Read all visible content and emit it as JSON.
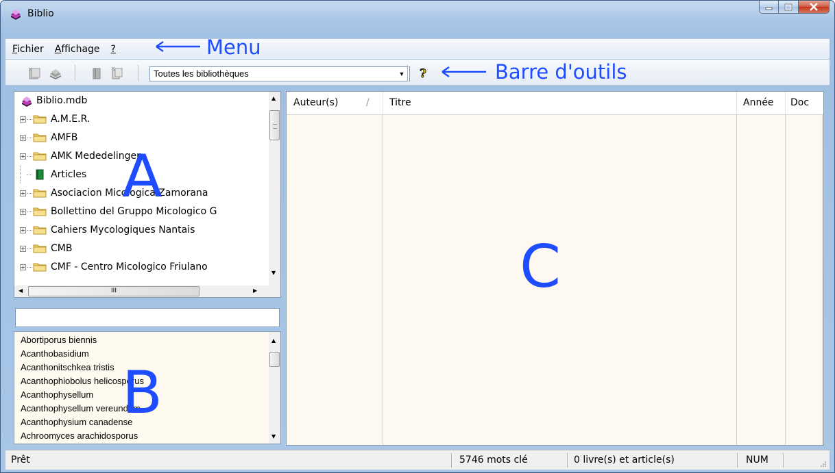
{
  "window": {
    "title": "Biblio"
  },
  "menu": {
    "file": "Fichier",
    "file_accel": "F",
    "file_rest": "ichier",
    "view": "Affichage",
    "view_accel": "A",
    "view_rest": "ffichage",
    "help": "?"
  },
  "toolbar": {
    "library_select": "Toutes les bibliothèques"
  },
  "annotations": {
    "menu": "Menu",
    "toolbar": "Barre d'outils",
    "pane_a": "A",
    "pane_b": "B",
    "pane_c": "C"
  },
  "tree": {
    "root": "Biblio.mdb",
    "items": [
      "A.M.E.R.",
      "AMFB",
      "AMK Mededelingen",
      "Articles",
      "Asociacion Micologica Zamorana",
      "Bollettino del Gruppo Micologico G",
      "Cahiers Mycologiques Nantais",
      "CMB",
      "CMF - Centro Micologico Friulano"
    ],
    "hscroll_grip": "III"
  },
  "keywords": {
    "search_value": "",
    "items": [
      "Abortiporus biennis",
      "Acanthobasidium",
      "Acanthonitschkea tristis",
      "Acanthophiobolus helicosporus",
      "Acanthophysellum",
      "Acanthophysellum vereundum",
      "Acanthophysium canadense",
      "Achroomyces arachidosporus"
    ]
  },
  "grid": {
    "columns": [
      "Auteur(s)",
      "Titre",
      "Année",
      "Doc"
    ],
    "sort_indicator": "/"
  },
  "status": {
    "ready": "Prêt",
    "keywords_count": "5746 mots clé",
    "records": "0 livre(s) et article(s)",
    "num": "NUM"
  },
  "colors": {
    "annotation": "#1f4cff",
    "list_bg": "#fdf9f0",
    "folder": "#f3d36b"
  },
  "icons": [
    "book-stack-icon",
    "minimize-icon",
    "maximize-icon",
    "close-icon",
    "add-library-icon",
    "library-icon",
    "add-document-icon",
    "paste-document-icon",
    "help-icon",
    "folder-icon",
    "green-book-icon"
  ]
}
